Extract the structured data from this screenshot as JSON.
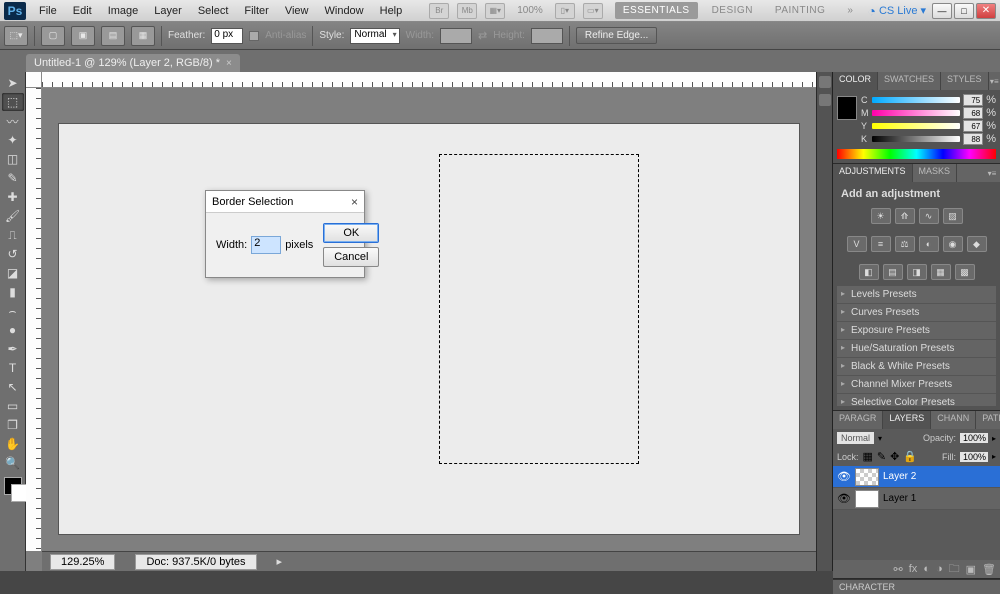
{
  "menu": {
    "items": [
      "File",
      "Edit",
      "Image",
      "Layer",
      "Select",
      "Filter",
      "View",
      "Window",
      "Help"
    ]
  },
  "menubar_zoom": "100%",
  "workspace": {
    "essentials": "ESSENTIALS",
    "design": "DESIGN",
    "painting": "PAINTING",
    "more": "»",
    "cslive": "CS Live"
  },
  "optbar": {
    "feather_label": "Feather:",
    "feather_value": "0 px",
    "antialias": "Anti-alias",
    "style_label": "Style:",
    "style_value": "Normal",
    "width_label": "Width:",
    "height_label": "Height:",
    "refine": "Refine Edge..."
  },
  "doctab": {
    "title": "Untitled-1 @ 129% (Layer 2, RGB/8) *"
  },
  "status": {
    "zoom": "129.25%",
    "doc": "Doc: 937.5K/0 bytes"
  },
  "color_panel": {
    "tabs": [
      "COLOR",
      "SWATCHES",
      "STYLES"
    ],
    "channels": [
      {
        "l": "C",
        "v": "75",
        "u": "%"
      },
      {
        "l": "M",
        "v": "68",
        "u": "%"
      },
      {
        "l": "Y",
        "v": "67",
        "u": "%"
      },
      {
        "l": "K",
        "v": "88",
        "u": "%"
      }
    ]
  },
  "adjustments_panel": {
    "tabs": [
      "ADJUSTMENTS",
      "MASKS"
    ],
    "heading": "Add an adjustment",
    "presets": [
      "Levels Presets",
      "Curves Presets",
      "Exposure Presets",
      "Hue/Saturation Presets",
      "Black & White Presets",
      "Channel Mixer Presets",
      "Selective Color Presets"
    ]
  },
  "layers_panel": {
    "tabs": [
      "PARAGR",
      "LAYERS",
      "CHANN",
      "PATHS"
    ],
    "blend": "Normal",
    "opacity_label": "Opacity:",
    "opacity": "100%",
    "lock_label": "Lock:",
    "fill_label": "Fill:",
    "fill": "100%",
    "layers": [
      {
        "name": "Layer 2",
        "active": true,
        "checker": true
      },
      {
        "name": "Layer 1",
        "active": false,
        "checker": false
      }
    ]
  },
  "character_tab": "CHARACTER",
  "dialog": {
    "title": "Border Selection",
    "width_label": "Width:",
    "width_value": "2",
    "unit": "pixels",
    "ok": "OK",
    "cancel": "Cancel"
  }
}
